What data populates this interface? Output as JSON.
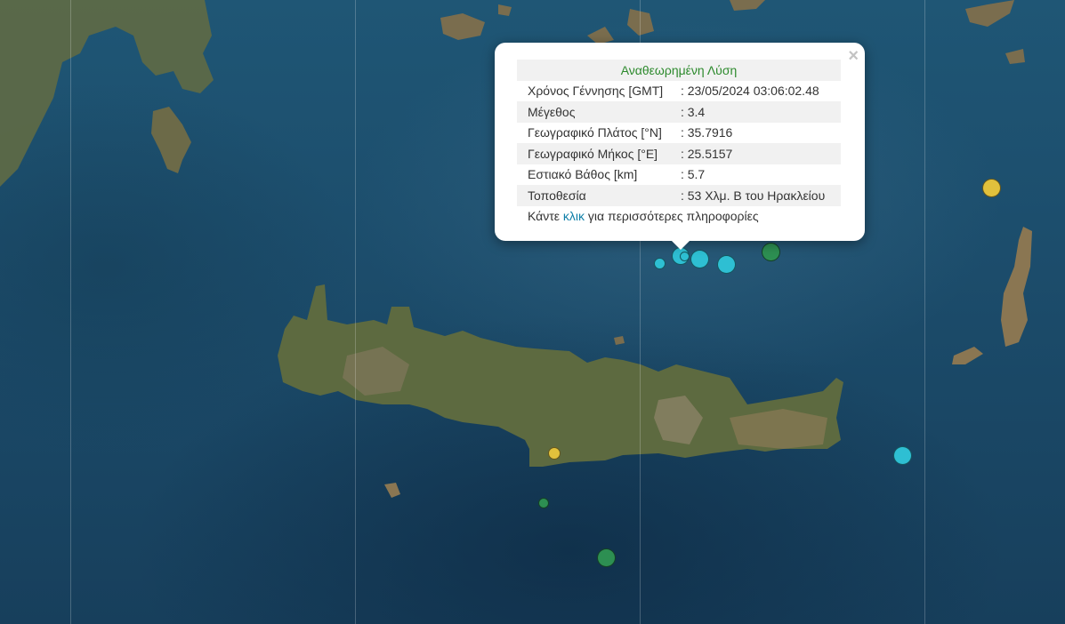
{
  "map": {
    "marker_colors": {
      "cyan": "#2ebfd3",
      "green": "#2d8f52",
      "yellow": "#e1c13c"
    }
  },
  "popup": {
    "title": "Αναθεωρημένη Λύση",
    "close_icon": "×",
    "rows": [
      {
        "label": "Χρόνος Γέννησης [GMT]",
        "value": ": 23/05/2024 03:06:02.48"
      },
      {
        "label": "Μέγεθος",
        "value": ": 3.4"
      },
      {
        "label": "Γεωγραφικό Πλάτος [°N]",
        "value": ": 35.7916"
      },
      {
        "label": "Γεωγραφικό Μήκος [°E]",
        "value": ": 25.5157"
      },
      {
        "label": "Εστιακό Βάθος [km]",
        "value": ": 5.7"
      },
      {
        "label": "Τοποθεσία",
        "value": ": 53 Χλμ. Β του Ηρακλείου"
      }
    ],
    "footer": {
      "before": "Κάντε ",
      "link": "κλικ",
      "after": " για περισσότερες πληροφορίες"
    }
  }
}
